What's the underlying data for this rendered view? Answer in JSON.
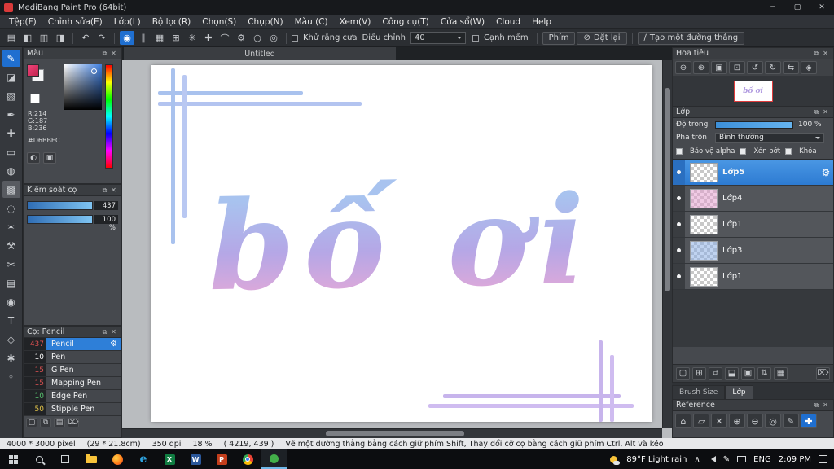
{
  "colors": {
    "accent_blue": "#1f6fd0",
    "layer_selected": "#2e7fd8",
    "viewport_red": "#e03c3c",
    "art_gradient_top": "#a8c3ef",
    "art_gradient_bottom": "#e3a8d8",
    "app_icon_red": "#d93a3a"
  },
  "icons": {
    "popout": "⧉",
    "close": "✕"
  },
  "titlebar": {
    "title": "MediBang Paint Pro (64bit)",
    "minimize_glyph": "─",
    "maximize_glyph": "▢",
    "close_glyph": "✕"
  },
  "menubar": {
    "items": [
      "Tệp(F)",
      "Chỉnh sửa(E)",
      "Lớp(L)",
      "Bộ lọc(R)",
      "Chọn(S)",
      "Chụp(N)",
      "Màu (C)",
      "Xem(V)",
      "Công cụ(T)",
      "Cửa sổ(W)",
      "Cloud",
      "Help"
    ]
  },
  "toolbar": {
    "file_icons": [
      "▤",
      "◧",
      "▥",
      "◨"
    ],
    "undo_glyph": "↶",
    "redo_glyph": "↷",
    "option_icons": [
      "◉",
      "∥",
      "▦",
      "⊞",
      "✳",
      "✚",
      "⌒",
      "⚙",
      "○",
      "◎"
    ],
    "antialias_label": "Khử răng cưa",
    "adjust_label": "Điều chỉnh",
    "adjust_value": "40",
    "soft_edge_label": "Cạnh mềm",
    "key_button": "Phím",
    "reset_icon": "⊘",
    "reset_button": "Đặt lại",
    "line_tool_glyph": "∕",
    "line_tool_label": "Tạo một đường thẳng"
  },
  "toolstrip": {
    "tools": [
      {
        "name": "brush",
        "glyph": "✎"
      },
      {
        "name": "eraser",
        "glyph": "◪"
      },
      {
        "name": "select",
        "glyph": "▧"
      },
      {
        "name": "pen",
        "glyph": "✒"
      },
      {
        "name": "move",
        "glyph": "✚"
      },
      {
        "name": "rectangle",
        "glyph": "▭"
      },
      {
        "name": "bucket",
        "glyph": "◍"
      },
      {
        "name": "gradient",
        "glyph": "▩"
      },
      {
        "name": "lasso",
        "glyph": "◌"
      },
      {
        "name": "wand",
        "glyph": "✶"
      },
      {
        "name": "operation",
        "glyph": "⚒"
      },
      {
        "name": "scissors",
        "glyph": "✂"
      },
      {
        "name": "divide",
        "glyph": "▤"
      },
      {
        "name": "zoom",
        "glyph": "◉"
      },
      {
        "name": "text",
        "glyph": "T"
      },
      {
        "name": "shape",
        "glyph": "◇"
      },
      {
        "name": "hand",
        "glyph": "✱"
      },
      {
        "name": "picker",
        "glyph": "◦"
      }
    ]
  },
  "color_panel": {
    "title": "Màu",
    "r_label": "R:214",
    "g_label": "G:187",
    "b_label": "B:236",
    "hex_label": "#D6BBEC"
  },
  "brush_control": {
    "title": "Kiểm soát cọ",
    "size_value": "437",
    "opacity_value": "100 %"
  },
  "brush_list": {
    "title": "Cọ: Pencil",
    "brushes": [
      {
        "size": "437",
        "name": "Pencil",
        "size_color": "#e05252"
      },
      {
        "size": "10",
        "name": "Pen",
        "size_color": "#ffffff"
      },
      {
        "size": "15",
        "name": "G Pen",
        "size_color": "#e05252"
      },
      {
        "size": "15",
        "name": "Mapping Pen",
        "size_color": "#e05252"
      },
      {
        "size": "10",
        "name": "Edge Pen",
        "size_color": "#58c470"
      },
      {
        "size": "50",
        "name": "Stipple Pen",
        "size_color": "#e8c84a"
      }
    ],
    "footer_icons": [
      "▢",
      "⧉",
      "▤",
      "⌦"
    ]
  },
  "canvas": {
    "tab_title": "Untitled",
    "artwork_text": "bố ơi"
  },
  "navigator": {
    "title": "Hoa tiêu",
    "icons": [
      "⊖",
      "⊕",
      "▣",
      "⊡",
      "↺",
      "↻",
      "⇆",
      "◈"
    ]
  },
  "layer_panel": {
    "title": "Lớp",
    "opacity_label": "Độ trong",
    "opacity_value": "100 %",
    "blend_label": "Pha trộn",
    "blend_value": "Bình thường",
    "check_alpha": "Bảo vệ alpha",
    "check_clip": "Xén bớt",
    "check_lock": "Khóa",
    "gear_glyph": "⚙",
    "layers": [
      {
        "name": "Lớp5"
      },
      {
        "name": "Lớp4"
      },
      {
        "name": "Lớp1"
      },
      {
        "name": "Lớp3"
      },
      {
        "name": "Lớp1"
      }
    ],
    "footer_icons": [
      "▢",
      "⊞",
      "⧉",
      "⬓",
      "▣",
      "⇅",
      "▦",
      "⌦"
    ]
  },
  "panel_tabs": {
    "brush_size": "Brush Size",
    "layer": "Lớp"
  },
  "reference_panel": {
    "title": "Reference",
    "icons": [
      "⌂",
      "▱",
      "✕",
      "⊕",
      "⊖",
      "◎",
      "✎",
      "✚"
    ]
  },
  "statusbar": {
    "size": "4000 * 3000 pixel",
    "dimensions": "(29 * 21.8cm)",
    "dpi": "350 dpi",
    "zoom": "18 %",
    "coords": "( 4219, 439 )",
    "hint": "Vẽ một đường thẳng bằng cách giữ phím Shift, Thay đổi cỡ cọ bằng cách giữ phím Ctrl, Alt và kéo"
  },
  "taskbar": {
    "edge_letter": "e",
    "excel_letter": "X",
    "word_letter": "W",
    "ppt_letter": "P",
    "weather": "89°F Light rain",
    "chevron": "∧",
    "pen_glyph": "✎",
    "lang": "ENG",
    "time": "2:09 PM"
  }
}
